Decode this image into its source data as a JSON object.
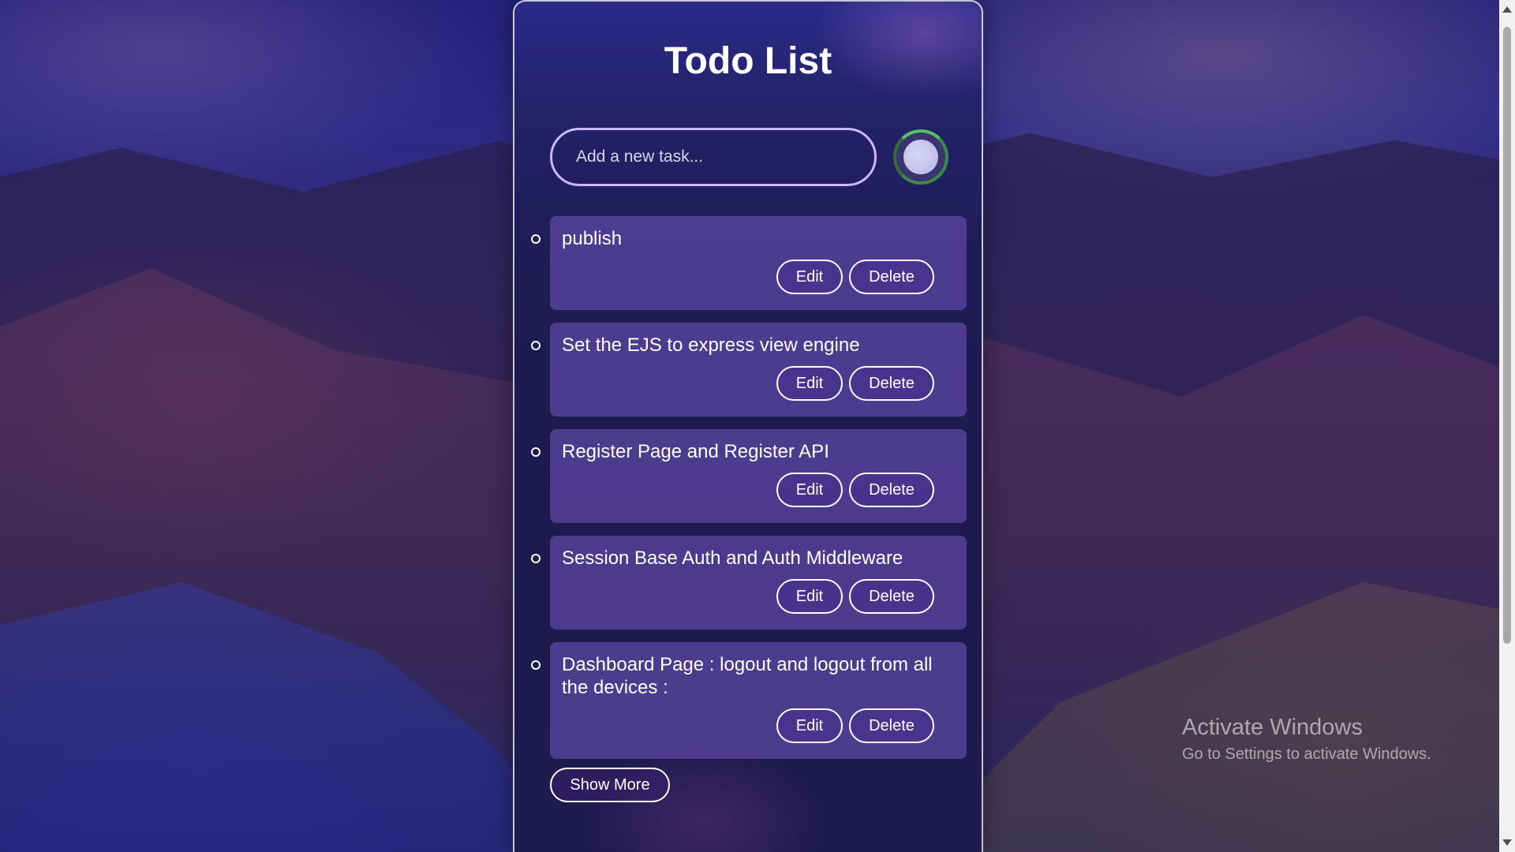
{
  "app": {
    "title": "Todo List",
    "input_placeholder": "Add a new task...",
    "show_more_label": "Show More"
  },
  "tasks": [
    {
      "text": "publish",
      "edit_label": "Edit",
      "delete_label": "Delete"
    },
    {
      "text": "Set the EJS to express view engine",
      "edit_label": "Edit",
      "delete_label": "Delete"
    },
    {
      "text": "Register Page and Register API",
      "edit_label": "Edit",
      "delete_label": "Delete"
    },
    {
      "text": "Session Base Auth and Auth Middleware",
      "edit_label": "Edit",
      "delete_label": "Delete"
    },
    {
      "text": "Dashboard Page : logout and logout from all the devices :",
      "edit_label": "Edit",
      "delete_label": "Delete"
    }
  ],
  "watermark": {
    "title": "Activate Windows",
    "subtitle": "Go to Settings to activate Windows."
  },
  "colors": {
    "accent_border": "#cbb9ff",
    "item_background": "#6950b4",
    "add_button_ring": "#56c35c"
  },
  "icons": {
    "add_button": "circle-add-icon",
    "bullet": "hollow-circle-bullet-icon"
  }
}
